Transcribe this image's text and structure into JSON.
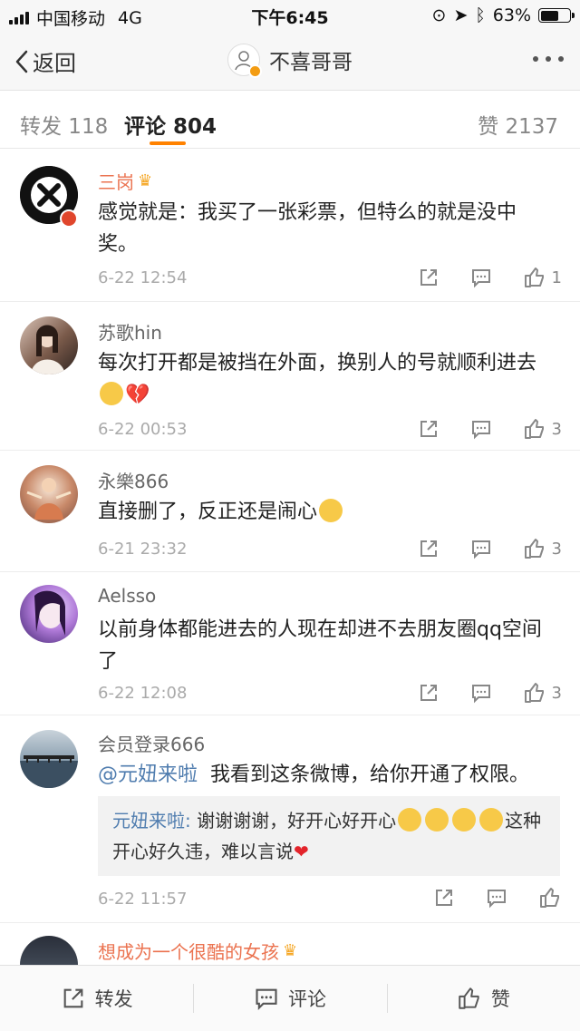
{
  "status_bar": {
    "carrier": "中国移动",
    "network": "4G",
    "time": "下午6:45",
    "battery": "63%",
    "battery_level": 0.63
  },
  "nav": {
    "back_label": "返回",
    "title": "不喜哥哥"
  },
  "tabs": {
    "repost": "转发 118",
    "comments": "评论 804",
    "likes": "赞 2137"
  },
  "comments": [
    {
      "user": "三岗",
      "text": "感觉就是：我买了一张彩票，但特么的就是没中奖。",
      "time": "6-22 12:54",
      "likes": "1"
    },
    {
      "user": "苏歌hin",
      "text": "每次打开都是被挡在外面，换别人的号就顺利进去",
      "time": "6-22 00:53",
      "likes": "3"
    },
    {
      "user": "永樂866",
      "text": "直接删了，反正还是闹心",
      "time": "6-21 23:32",
      "likes": "3"
    },
    {
      "user": "Aelsso",
      "text": "以前身体都能进去的人现在却进不去朋友圈qq空间了",
      "time": "6-22 12:08",
      "likes": "3"
    },
    {
      "user": "会员登录666",
      "mention": "@元妞来啦",
      "text": "我看到这条微博，给你开通了权限。",
      "reply_user": "元妞来啦:",
      "reply_text_a": "谢谢谢谢，好开心好开心",
      "reply_text_b": "这种开心好久违，难以言说",
      "time": "6-22 11:57"
    },
    {
      "user": "想成为一个很酷的女孩"
    }
  ],
  "bottom_bar": {
    "repost": "转发",
    "comment": "评论",
    "like": "赞"
  },
  "colors": {
    "accent": "#ff8200",
    "vip_name": "#eb7350",
    "link": "#507daf"
  }
}
